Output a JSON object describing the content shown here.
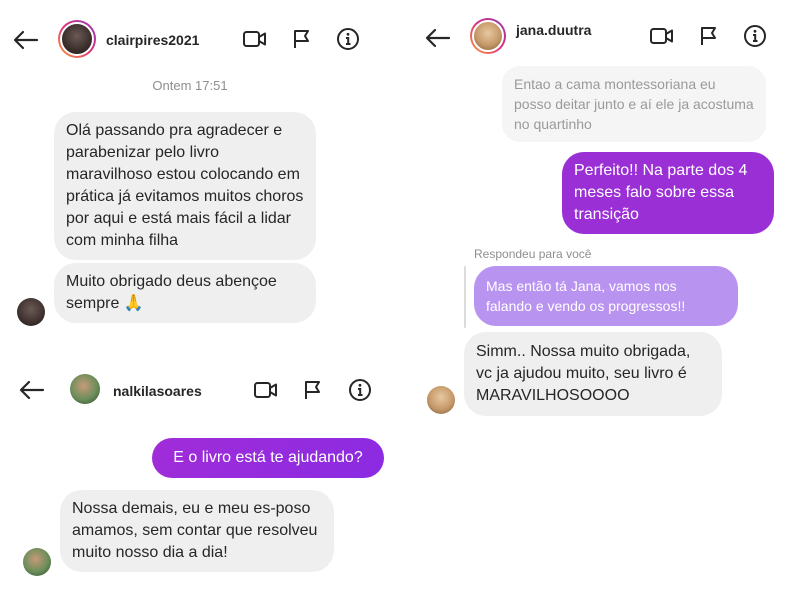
{
  "panel1": {
    "username": "clairpires2021",
    "timestamp": "Ontem 17:51",
    "messages": [
      "Olá passando pra agradecer e parabenizar pelo livro maravilhoso estou colocando em prática já evitamos muitos choros por aqui e está mais fácil a lidar com minha filha",
      "Muito obrigado deus abençoe sempre 🙏"
    ]
  },
  "panel2": {
    "username": "nalkilasoares",
    "sent": "E o livro está te ajudando?",
    "received": "Nossa demais, eu e meu es-poso amamos, sem contar que resolveu muito nosso dia a dia!"
  },
  "panel3": {
    "username": "jana.duutra",
    "faded_message": "Entao a cama montessoriana eu posso deitar junto e aí ele ja acostuma no quartinho",
    "sent": "Perfeito!! Na parte dos 4 meses falo sobre essa transição",
    "reply_label": "Respondeu para você",
    "replied_message": "Mas então tá Jana, vamos nos falando e vendo os progressos!!",
    "received": "Simm.. Nossa muito obrigada, vc ja ajudou muito, seu livro é MARAVILHOSOOOO"
  },
  "icons": [
    "back-arrow-icon",
    "video-camera-icon",
    "flag-icon",
    "info-icon",
    "prayer-hands-emoji"
  ],
  "colors": {
    "sent_bubble": "#a12cd8",
    "received_bubble": "#efefef",
    "reply_bubble": "#b993f0",
    "muted_text": "#8e8e8e"
  }
}
